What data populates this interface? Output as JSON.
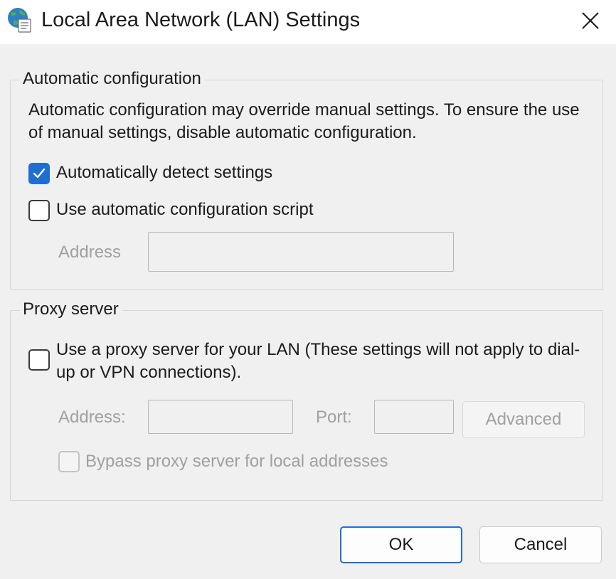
{
  "window": {
    "title": "Local Area Network (LAN) Settings",
    "close_glyph": "✕",
    "icon": "network-globe-icon"
  },
  "auto_config": {
    "legend": "Automatic configuration",
    "description": "Automatic configuration may override manual settings.  To ensure the use of manual settings, disable automatic configuration.",
    "auto_detect": {
      "label": "Automatically detect settings",
      "checked": true
    },
    "use_script": {
      "label": "Use automatic configuration script",
      "checked": false
    },
    "address_label": "Address",
    "address_value": ""
  },
  "proxy": {
    "legend": "Proxy server",
    "use_proxy": {
      "label": "Use a proxy server for your LAN (These settings will not apply to dial-up or VPN connections).",
      "checked": false
    },
    "address_label": "Address:",
    "address_value": "",
    "port_label": "Port:",
    "port_value": "",
    "advanced_label": "Advanced",
    "bypass": {
      "label": "Bypass proxy server for local addresses",
      "checked": false
    }
  },
  "buttons": {
    "ok": "OK",
    "cancel": "Cancel"
  },
  "colors": {
    "accent": "#1f6fd1",
    "background": "#f0f0f0",
    "disabled_text": "#a0a0a0"
  }
}
